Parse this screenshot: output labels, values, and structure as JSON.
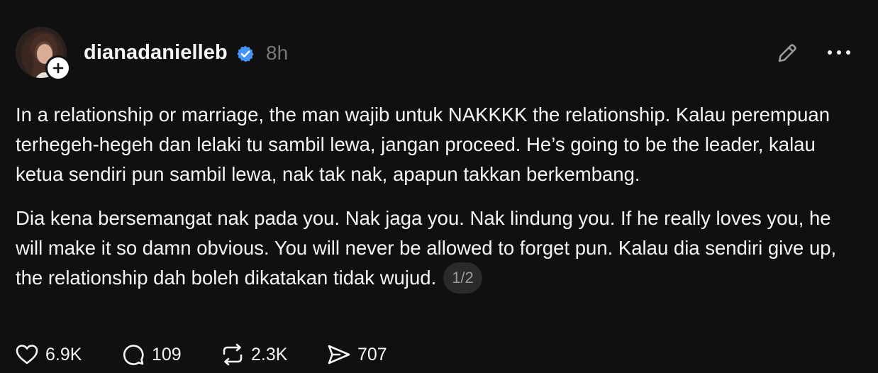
{
  "post": {
    "author": {
      "username": "dianadanielleb",
      "verified": true,
      "avatar_icon": "profile-photo",
      "follow_icon": "plus-icon"
    },
    "timestamp": "8h",
    "paragraphs": [
      "In a relationship or marriage, the man wajib untuk NAKKKK the relationship. Kalau perempuan terhegeh-hegeh dan lelaki tu sambil lewa, jangan proceed. He’s going to be the leader, kalau ketua sendiri pun sambil lewa, nak tak nak, apapun takkan berkembang.",
      "Dia kena bersemangat nak pada you. Nak jaga you. Nak lindung you. If he really loves you, he will make it so damn obvious. You will never be allowed to forget pun. Kalau dia sendiri give up, the relationship dah boleh dikatakan tidak wujud."
    ],
    "page_indicator": "1/2",
    "actions": {
      "likes": "6.9K",
      "replies": "109",
      "reposts": "2.3K",
      "shares": "707"
    }
  },
  "colors": {
    "background": "#101010",
    "text": "#f3f5f7",
    "muted": "#777777",
    "verified": "#4493f8"
  }
}
